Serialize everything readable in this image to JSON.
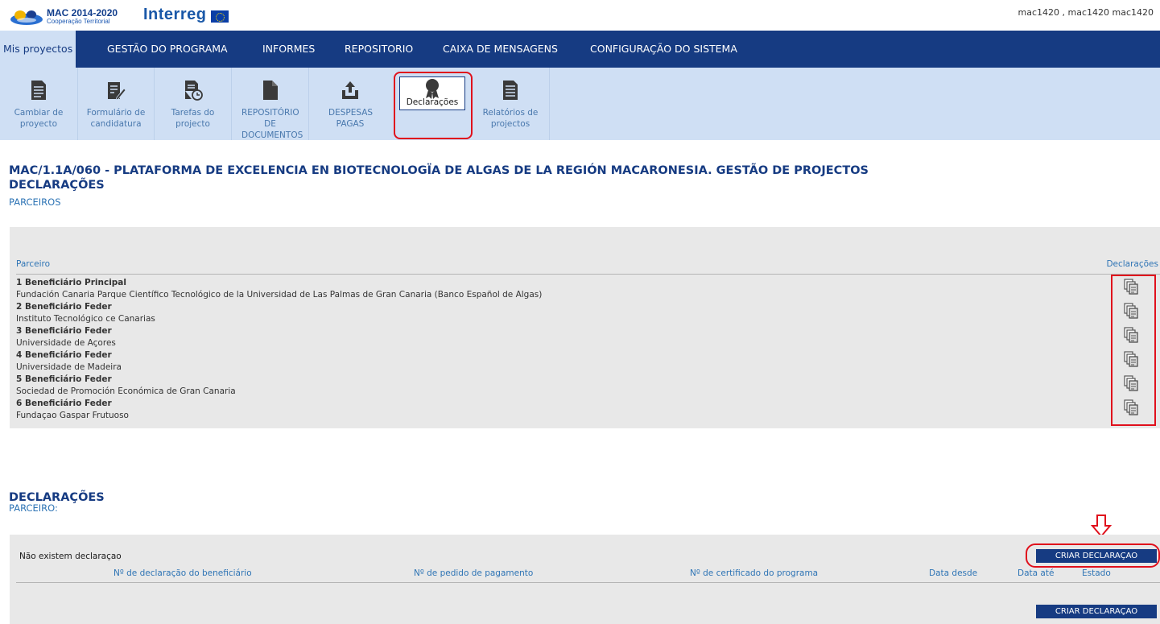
{
  "header": {
    "logo_mac_title": "MAC 2014-2020",
    "logo_mac_subtitle": "Cooperação Territorial",
    "logo_interreg": "Interreg",
    "user": "mac1420 , mac1420 mac1420"
  },
  "nav": {
    "items": [
      {
        "label": "Mis proyectos",
        "active": true
      },
      {
        "label": "GESTÃO DO PROGRAMA",
        "active": false
      },
      {
        "label": "INFORMES",
        "active": false
      },
      {
        "label": "REPOSITORIO",
        "active": false
      },
      {
        "label": "CAIXA DE MENSAGENS",
        "active": false
      },
      {
        "label": "CONFIGURAÇÃO DO SISTEMA",
        "active": false
      }
    ]
  },
  "toolbar": {
    "items": [
      {
        "label": "Cambiar de proyecto",
        "icon": "document-icon"
      },
      {
        "label": "Formulário de candidatura",
        "icon": "form-edit-icon"
      },
      {
        "label": "Tarefas do projecto",
        "icon": "clock-document-icon"
      },
      {
        "label": "REPOSITÓRIO DE DOCUMENTOS",
        "icon": "file-icon"
      },
      {
        "label": "DESPESAS PAGAS",
        "icon": "upload-icon"
      },
      {
        "label": "Declarações",
        "icon": "award-icon",
        "selected": true
      },
      {
        "label": "Relatórios de projectos",
        "icon": "report-icon"
      }
    ]
  },
  "page": {
    "title": "MAC/1.1A/060 - PLATAFORMA DE EXCELENCIA EN BIOTECNOLOGÏA DE ALGAS DE LA REGIÓN MACARONESIA. GESTÃO DE PROJECTOS",
    "section": "DECLARAÇÕES",
    "subsection": "PARCEIROS"
  },
  "partners_table": {
    "col_partner": "Parceiro",
    "col_declarations": "Declarações",
    "rows": [
      {
        "role": "1 Beneficiário Principal",
        "name": "Fundación Canaria Parque Científico Tecnológico de la Universidad de Las Palmas de Gran Canaria (Banco Español de Algas)"
      },
      {
        "role": "2 Beneficiário Feder",
        "name": "Instituto Tecnológico ce Canarias"
      },
      {
        "role": "3 Beneficiário Feder",
        "name": "Universidade de Açores"
      },
      {
        "role": "4 Beneficiário Feder",
        "name": "Universidade de Madeira"
      },
      {
        "role": "5 Beneficiário Feder",
        "name": "Sociedad de Promoción Económica de Gran Canaria"
      },
      {
        "role": "6 Beneficiário Feder",
        "name": "Fundaçao Gaspar Frutuoso"
      }
    ]
  },
  "declarations": {
    "title": "DECLARAÇÕES",
    "subtitle": "PARCEIRO:",
    "empty_message": "Não existem declaraçao",
    "columns": [
      "Nº de declaração do beneficiário",
      "Nº de pedido de pagamento",
      "Nº de certificado do programa",
      "Data desde",
      "Data até",
      "Estado"
    ],
    "create_button": "CRIAR DECLARAÇAO"
  },
  "colors": {
    "nav_bg": "#163b82",
    "subbar_bg": "#cfdff4",
    "panel_bg": "#e8e8e8",
    "link_blue": "#2e74b5",
    "highlight_red": "#e0101c"
  }
}
